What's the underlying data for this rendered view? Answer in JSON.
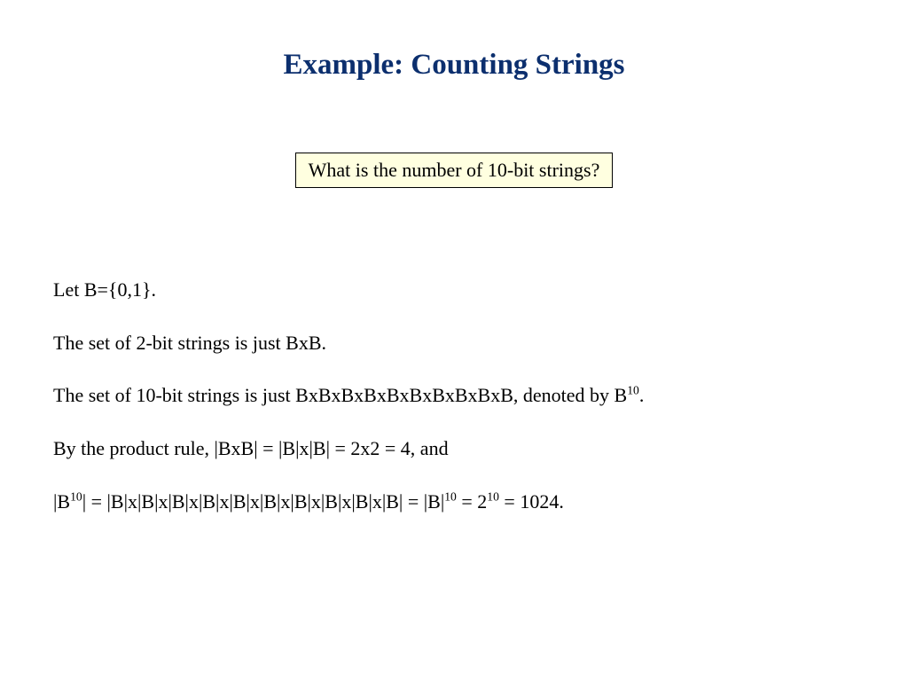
{
  "slide": {
    "title": "Example: Counting Strings",
    "question": "What is the number of 10-bit strings?",
    "p1": "Let B={0,1}.",
    "p2": "The set of 2-bit strings is just BxB.",
    "p3_a": "The set of 10-bit strings is just BxBxBxBxBxBxBxBxBxB, denoted by B",
    "p3_sup": "10",
    "p3_b": ".",
    "p4": "By the product rule, |BxB| = |B|x|B| = 2x2 = 4, and",
    "p5_a": "|B",
    "p5_sup1": "10",
    "p5_b": "| = |B|x|B|x|B|x|B|x|B|x|B|x|B|x|B|x|B|x|B| = |B|",
    "p5_sup2": "10",
    "p5_c": " = 2",
    "p5_sup3": "10",
    "p5_d": " = 1024."
  }
}
